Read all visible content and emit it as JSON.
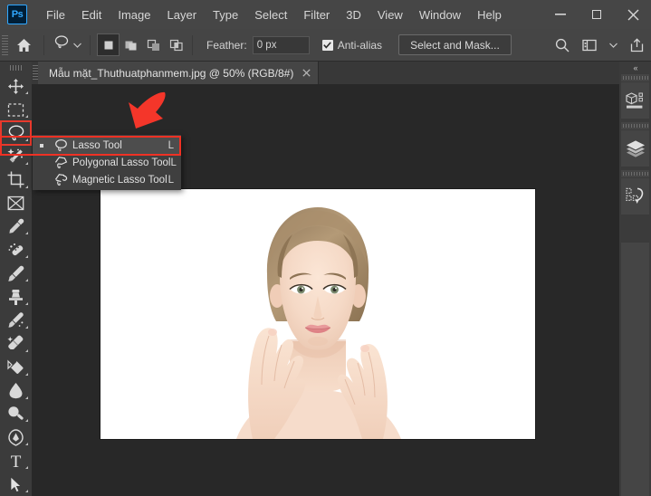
{
  "app": {
    "name": "Adobe Photoshop",
    "logo_text": "Ps"
  },
  "menubar": {
    "items": [
      "File",
      "Edit",
      "Image",
      "Layer",
      "Type",
      "Select",
      "Filter",
      "3D",
      "View",
      "Window",
      "Help"
    ],
    "window_controls": [
      {
        "name": "minimize",
        "glyph": "—"
      },
      {
        "name": "maximize",
        "glyph": "□"
      },
      {
        "name": "close",
        "glyph": "✕"
      }
    ]
  },
  "options_bar": {
    "home_icon": "home-icon",
    "active_tool_icon": "lasso-icon",
    "tool_preset_chevron": "chevron-down-icon",
    "selection_modes": [
      {
        "name": "new-selection",
        "active": true
      },
      {
        "name": "add-to-selection",
        "active": false
      },
      {
        "name": "subtract-from-selection",
        "active": false
      },
      {
        "name": "intersect-with-selection",
        "active": false
      }
    ],
    "feather_label": "Feather:",
    "feather_value": "0 px",
    "antialias_label": "Anti-alias",
    "antialias_checked": true,
    "select_and_mask_label": "Select and Mask...",
    "right_icons": [
      "search-icon",
      "workspace-icon",
      "chevron-down-icon",
      "share-icon"
    ]
  },
  "document_tab": {
    "title": "Mẫu mặt_Thuthuatphanmem.jpg @ 50% (RGB/8#)",
    "close_glyph": "✕"
  },
  "toolbar": {
    "tools": [
      {
        "name": "move-tool",
        "icon": "move-icon",
        "has_flyout": true,
        "selected": false
      },
      {
        "name": "rectangular-marquee-tool",
        "icon": "marquee-icon",
        "has_flyout": true,
        "selected": false
      },
      {
        "name": "lasso-tool",
        "icon": "lasso-icon",
        "has_flyout": true,
        "selected": true
      },
      {
        "name": "quick-selection-tool",
        "icon": "magic-wand-icon",
        "has_flyout": true,
        "selected": false
      },
      {
        "name": "crop-tool",
        "icon": "crop-icon",
        "has_flyout": true,
        "selected": false
      },
      {
        "name": "frame-tool",
        "icon": "frame-icon",
        "has_flyout": false,
        "selected": false
      },
      {
        "name": "eyedropper-tool",
        "icon": "eyedropper-icon",
        "has_flyout": true,
        "selected": false
      },
      {
        "name": "spot-healing-brush-tool",
        "icon": "healing-brush-icon",
        "has_flyout": true,
        "selected": false
      },
      {
        "name": "brush-tool",
        "icon": "brush-icon",
        "has_flyout": true,
        "selected": false
      },
      {
        "name": "clone-stamp-tool",
        "icon": "clone-stamp-icon",
        "has_flyout": true,
        "selected": false
      },
      {
        "name": "history-brush-tool",
        "icon": "history-brush-icon",
        "has_flyout": true,
        "selected": false
      },
      {
        "name": "eraser-tool",
        "icon": "eraser-icon",
        "has_flyout": true,
        "selected": false
      },
      {
        "name": "gradient-tool",
        "icon": "paint-bucket-icon",
        "has_flyout": true,
        "selected": false
      },
      {
        "name": "blur-tool",
        "icon": "blur-drop-icon",
        "has_flyout": true,
        "selected": false
      },
      {
        "name": "dodge-tool",
        "icon": "dodge-icon",
        "has_flyout": true,
        "selected": false
      },
      {
        "name": "pen-tool",
        "icon": "pen-icon",
        "has_flyout": true,
        "selected": false
      },
      {
        "name": "horizontal-type-tool",
        "icon": "type-icon",
        "has_flyout": true,
        "selected": false
      },
      {
        "name": "path-selection-tool",
        "icon": "path-arrow-icon",
        "has_flyout": true,
        "selected": false
      }
    ]
  },
  "flyout_menu": {
    "items": [
      {
        "label": "Lasso Tool",
        "shortcut": "L",
        "icon": "lasso-icon",
        "active": true,
        "bullet": true
      },
      {
        "label": "Polygonal Lasso Tool",
        "shortcut": "L",
        "icon": "polygonal-lasso-icon",
        "active": false,
        "bullet": false
      },
      {
        "label": "Magnetic Lasso Tool",
        "shortcut": "L",
        "icon": "magnetic-lasso-icon",
        "active": false,
        "bullet": false
      }
    ]
  },
  "annotation": {
    "type": "red-arrow",
    "color": "#ef3124",
    "points_to": "Lasso Tool"
  },
  "right_dock": {
    "collapse_glyph": "«",
    "panels": [
      {
        "name": "properties-panel",
        "icon": "properties-cube-icon"
      },
      {
        "name": "layers-panel",
        "icon": "layers-icon"
      },
      {
        "name": "actions-panel",
        "icon": "actions-icon"
      }
    ]
  },
  "colors": {
    "chrome": "#464646",
    "options_bar": "#454545",
    "panel": "#3b3b3b",
    "canvas_bg": "#282828",
    "accent_red": "#ef3124",
    "text": "#d6d6d6",
    "ps_blue": "#31a8ff"
  }
}
